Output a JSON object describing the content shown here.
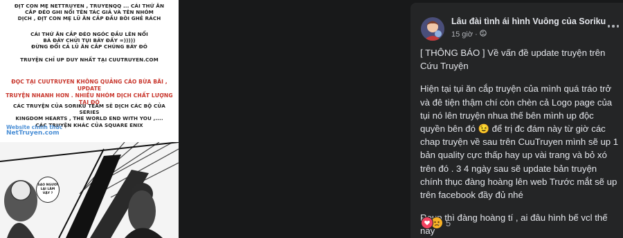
{
  "manga": {
    "credits": [
      "Địt con mẹ NETTRUYEN , TRUYENQQ ... cái thứ ăn",
      "cắp đéo ghi nổi tên tác giả và tên nhóm",
      "dịch , địt con mẹ lũ ăn cắp đầu bòi ghẻ rách"
    ],
    "insult": [
      "Cái thứ ăn cắp đéo ngóc đầu lên nổi",
      "bá đây chửi tụi bây đấy =)))))",
      "Đừng đổi cả lũ ăn cắp chúng bây đó"
    ],
    "only_upload": "Truyện chỉ up duy nhất tại Cuutruyen.com",
    "notice": [
      "Đọc tại Cuutruyen không quảng cáo bừa bãi , update",
      "truyện nhanh hơn . Nhiều nhóm dịch chất lượng",
      "tại đó"
    ],
    "series": [
      "Các truyện của Soriku team sẽ dịch các bộ của series",
      "Kingdom Hearts , The World End With You ,....",
      "Các truyện khác của Square Enix"
    ],
    "watermark_line1": "Website chính thức",
    "watermark_line2": "NetTruyen.com",
    "bubble_text": "Sao ngươi lại làm vậy ?"
  },
  "post": {
    "page_name": "Lâu đài tình ái hình Vuông của Soriku",
    "time": "15 giờ",
    "privacy_icon": "globe-icon",
    "more_icon": "more-options-icon",
    "paragraphs": [
      "[ THÔNG BÁO ] Về vấn đề update truyện trên Cứu Truyện",
      "Hiện tại tụi ăn cắp truyện của mình quá tráo trở và đê tiện thậm chí còn chèn cả Logo page của tụi nó lên truyện nhua thế bên mình up độc quyền bên đó 😉 để trị đc đám này từ giờ các chap truyện về sau trên CuuTruyen mình sẽ up 1 bản quality cực thấp hay up vài trang và bỏ xó trên đó . 3 4 ngày sau sẽ update bản truyện chính thục đàng hoàng lên web Trước mắt sẽ up trên facebook đầy đủ nhé",
      "Reup thì đàng hoàng tí , ai đâu hình bế vcl thế này"
    ],
    "reaction_count": "5"
  },
  "colors": {
    "background": "#18191a",
    "card": "#242526",
    "text_primary": "#e4e6eb",
    "text_secondary": "#b0b3b8"
  }
}
